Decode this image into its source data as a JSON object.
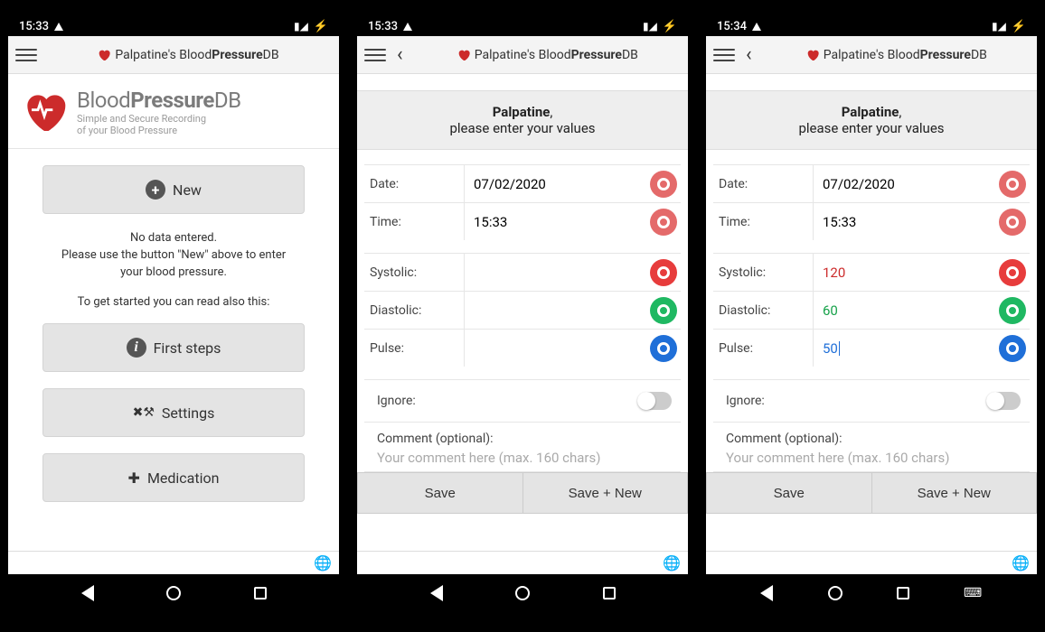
{
  "status": {
    "time1": "15:33",
    "time2": "15:33",
    "time3": "15:34"
  },
  "appbar": {
    "title_pre": "Palpatine's ",
    "title_brand1": "Blood",
    "title_brand2": "Pressure",
    "title_brand3": "DB"
  },
  "screen1": {
    "brand_l1_a": "Blood",
    "brand_l1_b": "Pressure",
    "brand_l1_c": "DB",
    "tagline1": "Simple and Secure Recording",
    "tagline2": "of your Blood Pressure",
    "btn_new": "New",
    "info1": "No data entered.",
    "info2": "Please use the button \"New\" above to enter your blood pressure.",
    "info3": "To get started you can read also this:",
    "btn_first": "First steps",
    "btn_settings": "Settings",
    "btn_med": "Medication"
  },
  "form": {
    "name": "Palpatine",
    "prompt_line": "please enter your values",
    "date_label": "Date:",
    "date_value": "07/02/2020",
    "time_label": "Time:",
    "time_value": "15:33",
    "sys_label": "Systolic:",
    "dia_label": "Diastolic:",
    "pul_label": "Pulse:",
    "ignore_label": "Ignore:",
    "comment_label": "Comment (optional):",
    "comment_ph": "Your comment here (max. 160 chars)",
    "save": "Save",
    "save_new": "Save + New"
  },
  "screen3": {
    "sys": "120",
    "dia": "60",
    "pul": "50"
  }
}
